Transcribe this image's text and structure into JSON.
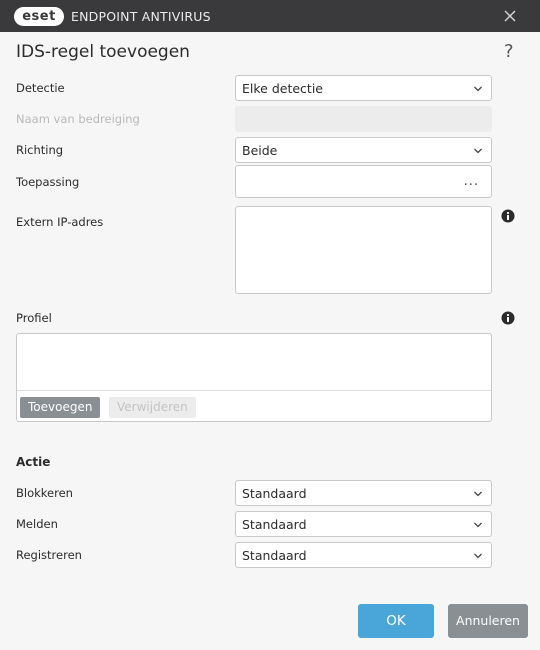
{
  "titlebar": {
    "logo_text": "eset",
    "product_name": "ENDPOINT ANTIVIRUS"
  },
  "dialog": {
    "title": "IDS-regel toevoegen",
    "help_glyph": "?"
  },
  "form": {
    "detection": {
      "label": "Detectie",
      "value": "Elke detectie"
    },
    "threat_name": {
      "label": "Naam van bedreiging",
      "value": ""
    },
    "direction": {
      "label": "Richting",
      "value": "Beide"
    },
    "application": {
      "label": "Toepassing",
      "value": "",
      "browse_label": "..."
    },
    "remote_ip": {
      "label": "Extern IP-adres",
      "value": ""
    }
  },
  "profile": {
    "label": "Profiel",
    "items": [],
    "add_label": "Toevoegen",
    "remove_label": "Verwijderen"
  },
  "action": {
    "heading": "Actie",
    "block": {
      "label": "Blokkeren",
      "value": "Standaard"
    },
    "notify": {
      "label": "Melden",
      "value": "Standaard"
    },
    "log": {
      "label": "Registreren",
      "value": "Standaard"
    }
  },
  "buttons": {
    "ok_label": "OK",
    "cancel_label": "Annuleren"
  },
  "colors": {
    "titlebar_bg": "#3a3a3c",
    "ok_button": "#4aa6d9",
    "neutral_button": "#8a8f94"
  },
  "icons": {
    "close": "close-icon",
    "help": "help-icon",
    "info": "info-icon",
    "dropdown": "chevron-down-icon",
    "browse": "ellipsis-icon"
  }
}
